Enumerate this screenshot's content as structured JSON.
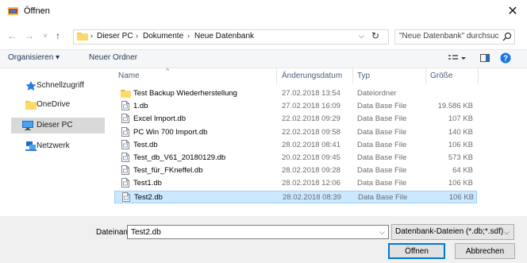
{
  "window": {
    "title": "Öffnen"
  },
  "nav": {
    "back": "←",
    "forward": "→",
    "recent": "˅",
    "up": "↑",
    "breadcrumb": [
      "Dieser PC",
      "Dokumente",
      "Neue Datenbank"
    ],
    "search_placeholder": "\"Neue Datenbank\" durchsuch..."
  },
  "toolbar": {
    "organize": "Organisieren ▾",
    "new_folder": "Neuer Ordner"
  },
  "sidebar": {
    "items": [
      {
        "label": "Schnellzugriff",
        "icon": "star-icon"
      },
      {
        "label": "OneDrive",
        "icon": "folder-icon"
      },
      {
        "label": "Dieser PC",
        "icon": "computer-icon",
        "selected": true
      },
      {
        "label": "Netzwerk",
        "icon": "network-icon"
      }
    ]
  },
  "columns": {
    "name": "Name",
    "date": "Änderungsdatum",
    "type": "Typ",
    "size": "Größe"
  },
  "files": [
    {
      "name": "Test Backup Wiederherstellung",
      "date": "27.02.2018 13:54",
      "type": "Dateiordner",
      "size": "",
      "icon": "folder-icon"
    },
    {
      "name": "1.db",
      "date": "27.02.2018 16:09",
      "type": "Data Base File",
      "size": "19.586 KB",
      "icon": "file-icon"
    },
    {
      "name": "Excel Import.db",
      "date": "22.02.2018 09:29",
      "type": "Data Base File",
      "size": "107 KB",
      "icon": "file-icon"
    },
    {
      "name": "PC Win 700 Import.db",
      "date": "22.02.2018 09:58",
      "type": "Data Base File",
      "size": "140 KB",
      "icon": "file-icon"
    },
    {
      "name": "Test.db",
      "date": "28.02.2018 08:41",
      "type": "Data Base File",
      "size": "106 KB",
      "icon": "file-icon"
    },
    {
      "name": "Test_db_V61_20180129.db",
      "date": "20.02.2018 09:45",
      "type": "Data Base File",
      "size": "573 KB",
      "icon": "file-icon"
    },
    {
      "name": "Test_für_FKneffel.db",
      "date": "28.02.2018 09:28",
      "type": "Data Base File",
      "size": "64 KB",
      "icon": "file-icon"
    },
    {
      "name": "Test1.db",
      "date": "28.02.2018 12:06",
      "type": "Data Base File",
      "size": "106 KB",
      "icon": "file-icon"
    },
    {
      "name": "Test2.db",
      "date": "28.02.2018 08:39",
      "type": "Data Base File",
      "size": "106 KB",
      "icon": "file-icon",
      "selected": true
    }
  ],
  "footer": {
    "filename_label": "Dateiname:",
    "filename_value": "Test2.db",
    "filetype": "Datenbank-Dateien (*.db;*.sdf)",
    "open": "Öffnen",
    "cancel": "Abbrechen"
  },
  "colors": {
    "selection": "#cce8ff",
    "accent": "#0078d7"
  }
}
